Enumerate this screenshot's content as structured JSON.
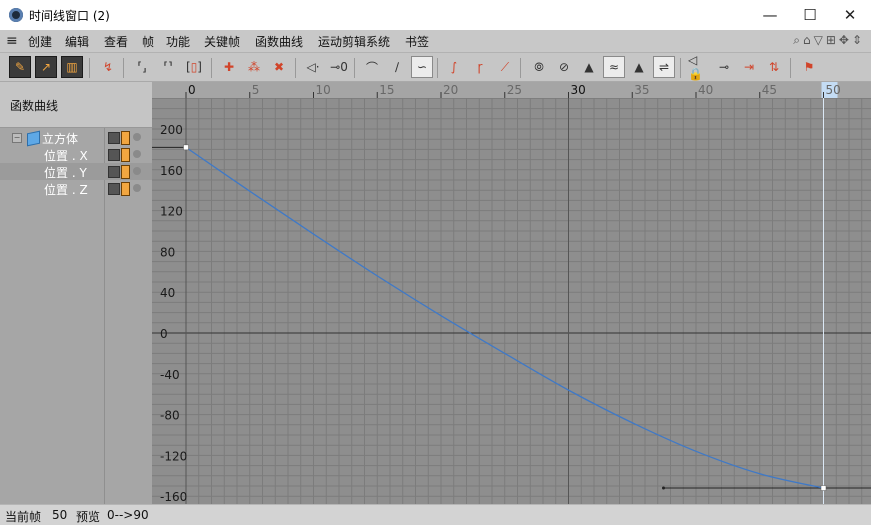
{
  "window": {
    "title": "时间线窗口 (2)",
    "minimize_glyph": "—",
    "maximize_glyph": "☐",
    "close_glyph": "✕"
  },
  "menu": {
    "icon": "hamburger-icon",
    "items": [
      "创建",
      "编辑",
      "查看",
      "帧",
      "功能",
      "关键帧",
      "函数曲线",
      "运动剪辑系统",
      "书签"
    ]
  },
  "toolbar": {
    "icons": [
      "key-mode-icon",
      "fcurve-mode-icon",
      "motion-mode-icon",
      "keyframe-select-icon",
      "frame-range-icon",
      "frame-all-icon",
      "frame-selected-icon",
      "add-key-icon",
      "add-track-keys-icon",
      "remove-keys-icon",
      "zero-length-tangent-icon",
      "zero-angle-tangent-icon",
      "spline-interp-icon",
      "linear-interp-icon",
      "step-interp-icon",
      "ease-in-icon",
      "ease-out-icon",
      "ease-both-icon",
      "clamp-tangent-icon",
      "break-tangent-icon",
      "lock-weight-icon",
      "auto-weight-icon",
      "lock-time-icon",
      "lock-value-icon",
      "lock-tangent-icon",
      "lock-tangent-length-icon",
      "lock-key-time-icon",
      "lock-key-value-icon",
      "snap-key-icon"
    ]
  },
  "left_panel": {
    "header": "函数曲线",
    "tracks": [
      {
        "label": "立方体",
        "type": "object",
        "selected": false
      },
      {
        "label": "位置 . X",
        "type": "track",
        "selected": false
      },
      {
        "label": "位置 . Y",
        "type": "track",
        "selected": true
      },
      {
        "label": "位置 . Z",
        "type": "track",
        "selected": false
      }
    ]
  },
  "colors": {
    "curve": "#3f79c7",
    "background": "#8e8e8e",
    "grid": "#7c7c7c",
    "highlight_frame": "#c4dcf4"
  },
  "chart_data": {
    "type": "line",
    "title": "",
    "xlabel": "",
    "ylabel": "",
    "xlim": [
      0,
      50
    ],
    "ylim": [
      -165,
      200
    ],
    "x_ticks": [
      0,
      5,
      10,
      15,
      20,
      25,
      30,
      35,
      40,
      45,
      50
    ],
    "y_ticks": [
      200,
      160,
      120,
      80,
      40,
      0,
      -40,
      -80,
      -120,
      -160
    ],
    "grid": true,
    "current_frame": 50,
    "keyframes": [
      {
        "x": 0,
        "y": 182
      },
      {
        "x": 50,
        "y": -152
      }
    ],
    "series": [
      {
        "x": [
          0,
          5,
          10,
          15,
          20,
          25,
          30,
          35,
          40,
          45,
          50
        ],
        "y": [
          182,
          139,
          97,
          56,
          17,
          -20,
          -56,
          -88,
          -116,
          -138,
          -152
        ]
      }
    ]
  },
  "status": {
    "current_frame_label": "当前帧",
    "current_frame": "50",
    "preview_label": "预览",
    "preview_range": "0-->90"
  }
}
